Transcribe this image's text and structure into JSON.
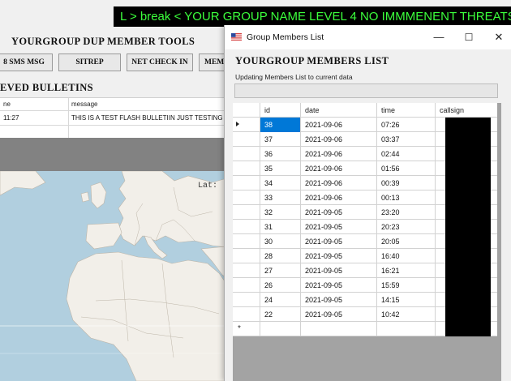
{
  "ticker": {
    "text": "L  > break <  YOUR GROUP NAME  LEVEL 4 NO IMMMENENT THREATS  >"
  },
  "tools": {
    "title": "YOURGROUP DUP MEMBER TOOLS",
    "buttons": [
      "8 SMS MSG",
      "SITREP",
      "NET CHECK IN",
      "MEM"
    ]
  },
  "bulletins": {
    "title": "EVED BULLETINS",
    "columns": [
      "ne",
      "message"
    ],
    "rows": [
      {
        "time": "11:27",
        "message": "THIS IS A TEST FLASH BULLETIIN JUST TESTING THE"
      }
    ]
  },
  "map": {
    "lat_label": "Lat:",
    "colors": {
      "sea": "#b1cfdf",
      "land": "#f2efe9"
    }
  },
  "dialog": {
    "title": "Group Members List",
    "controls": {
      "minimize": "—",
      "maximize": "☐",
      "close": "✕"
    },
    "heading": "YOURGROUP MEMBERS LIST",
    "status": "Updating Members List to current data",
    "grid": {
      "columns": [
        "id",
        "date",
        "time",
        "callsign"
      ],
      "selected_row": 0,
      "rows": [
        {
          "id": "38",
          "date": "2021-09-06",
          "time": "07:26"
        },
        {
          "id": "37",
          "date": "2021-09-06",
          "time": "03:37"
        },
        {
          "id": "36",
          "date": "2021-09-06",
          "time": "02:44"
        },
        {
          "id": "35",
          "date": "2021-09-06",
          "time": "01:56"
        },
        {
          "id": "34",
          "date": "2021-09-06",
          "time": "00:39"
        },
        {
          "id": "33",
          "date": "2021-09-06",
          "time": "00:13"
        },
        {
          "id": "32",
          "date": "2021-09-05",
          "time": "23:20"
        },
        {
          "id": "31",
          "date": "2021-09-05",
          "time": "20:23"
        },
        {
          "id": "30",
          "date": "2021-09-05",
          "time": "20:05"
        },
        {
          "id": "28",
          "date": "2021-09-05",
          "time": "16:40"
        },
        {
          "id": "27",
          "date": "2021-09-05",
          "time": "16:21"
        },
        {
          "id": "26",
          "date": "2021-09-05",
          "time": "15:59"
        },
        {
          "id": "24",
          "date": "2021-09-05",
          "time": "14:15"
        },
        {
          "id": "22",
          "date": "2021-09-05",
          "time": "10:42"
        }
      ],
      "new_row_marker": "*"
    },
    "colors": {
      "selection": "#0078d7",
      "redaction": "#000000"
    }
  }
}
